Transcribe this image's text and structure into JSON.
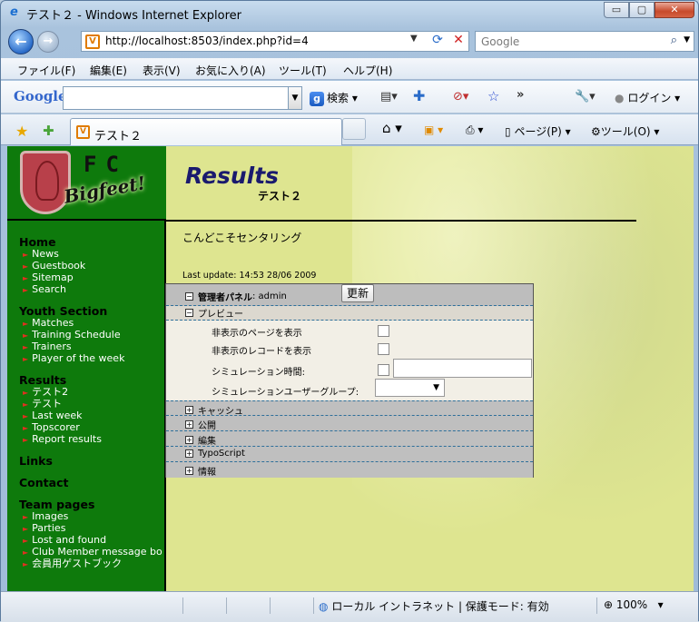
{
  "window": {
    "title": "テスト２ - Windows Internet Explorer",
    "controls": {
      "minimize": "▭",
      "maximize": "▢",
      "close": "✕"
    }
  },
  "navigation": {
    "url": "http://localhost:8503/index.php?id=4",
    "search_placeholder": "Google"
  },
  "menubar": {
    "items": [
      "ファイル(F)",
      "編集(E)",
      "表示(V)",
      "お気に入り(A)",
      "ツール(T)",
      "ヘルプ(H)"
    ]
  },
  "google_toolbar": {
    "logo": "Google",
    "search_label": "検索",
    "more": "»",
    "login_label": "ログイン"
  },
  "tabbar": {
    "tab_label": "テスト２",
    "page_menu": "ページ(P)",
    "tools_menu": "ツール(O)"
  },
  "sidebar": {
    "logo_fc": "FC",
    "logo_text": "Bigfeet!",
    "sections": [
      {
        "title": "Home",
        "items": [
          "News",
          "Guestbook",
          "Sitemap",
          "Search"
        ]
      },
      {
        "title": "Youth Section",
        "items": [
          "Matches",
          "Training Schedule",
          "Trainers",
          "Player of the week"
        ]
      },
      {
        "title": "Results",
        "items": [
          "テスト2",
          "テスト",
          "Last week",
          "Topscorer",
          "Report results"
        ]
      },
      {
        "title": "Links",
        "items": []
      },
      {
        "title": "Contact",
        "items": []
      },
      {
        "title": "Team pages",
        "items": [
          "Images",
          "Parties",
          "Lost and found",
          "Club Member message bo",
          "会員用ゲストブック"
        ]
      }
    ]
  },
  "main": {
    "title": "Results",
    "subtitle": "テスト２",
    "intro": "こんどこそセンタリング",
    "last_update": "Last update:  14:53 28/06 2009"
  },
  "admin_panel": {
    "header_label": "管理者パネル",
    "header_user": ": admin",
    "update_button": "更新",
    "preview_label": "プレビュー",
    "options": [
      {
        "label": "非表示のページを表示",
        "checked": false
      },
      {
        "label": "非表示のレコードを表示",
        "checked": false
      },
      {
        "label": "シミュレーション時間:",
        "checked": false,
        "value": ""
      },
      {
        "label": "シミュレーションユーザーグループ:",
        "value": ""
      }
    ],
    "sections": [
      "キャッシュ",
      "公開",
      "編集",
      "TypoScript",
      "情報"
    ]
  },
  "statusbar": {
    "zone": "ローカル イントラネット | 保護モード: 有効",
    "zoom": "100%"
  }
}
